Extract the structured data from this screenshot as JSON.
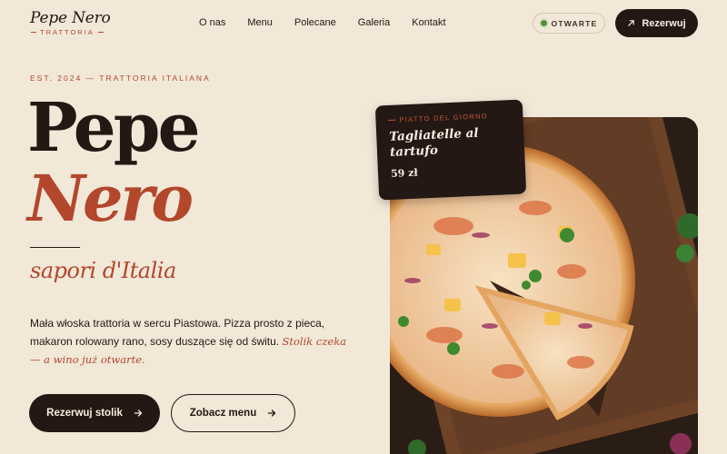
{
  "brand": {
    "name": "Pepe Nero",
    "subtitle": "TRATTORIA"
  },
  "nav": {
    "links": [
      "O nas",
      "Menu",
      "Polecane",
      "Galeria",
      "Kontakt"
    ]
  },
  "status": {
    "label": "OTWARTE",
    "color": "#5b8a3a"
  },
  "header_cta": {
    "label": "Rezerwuj",
    "icon": "arrow-up-right-icon"
  },
  "hero": {
    "eyebrow": "EST. 2024 — TRATTORIA ITALIANA",
    "title_line1": "Pepe",
    "title_line2": "Nero",
    "tagline": "sapori d'Italia",
    "description": "Mała włoska trattoria w sercu Piastowa. Pizza prosto z pieca, makaron rolowany rano, sosy duszące się od świtu.",
    "description_highlight": "Stolik czeka — a wino już otwarte.",
    "primary_button": "Rezerwuj stolik",
    "secondary_button": "Zobacz menu",
    "button_icon": "arrow-right-icon"
  },
  "special": {
    "label": "PIATTO DEL GIORNO",
    "name": "Tagliatelle al tartufo",
    "price": "59 zł"
  },
  "colors": {
    "background": "#f1e8d8",
    "dark": "#231813",
    "accent": "#b3472c"
  }
}
